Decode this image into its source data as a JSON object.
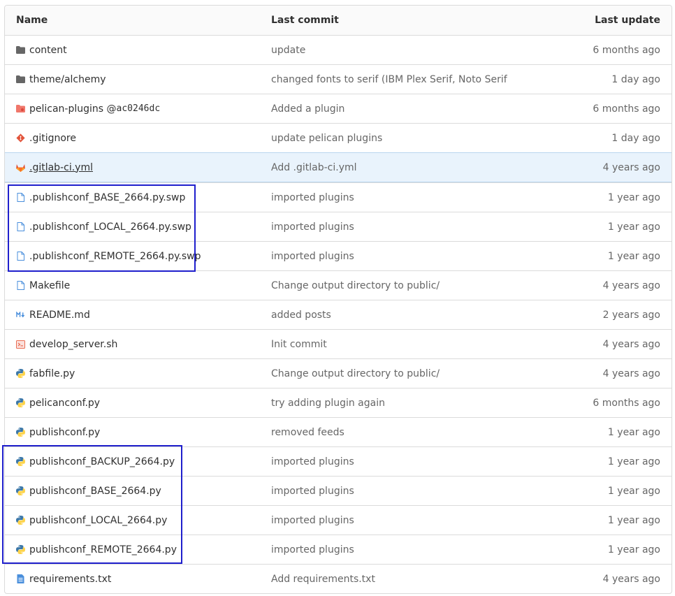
{
  "columns": {
    "name": "Name",
    "last_commit": "Last commit",
    "last_update": "Last update"
  },
  "rows": [
    {
      "name": "content",
      "commit": "update",
      "date": "6 months ago",
      "icon": "folder-icon"
    },
    {
      "name": "theme/alchemy",
      "commit": "changed fonts to serif (IBM Plex Serif, Noto Serif",
      "date": "1 day ago",
      "icon": "folder-icon"
    },
    {
      "name": "pelican-plugins @ ",
      "hash": "ac0246dc",
      "commit": "Added a plugin",
      "date": "6 months ago",
      "icon": "submodule-folder-icon"
    },
    {
      "name": ".gitignore",
      "commit": "update pelican plugins",
      "date": "1 day ago",
      "icon": "git-icon"
    },
    {
      "name": ".gitlab-ci.yml",
      "commit": "Add .gitlab-ci.yml",
      "date": "4 years ago",
      "icon": "gitlab-icon"
    },
    {
      "name": ".publishconf_BASE_2664.py.swp",
      "commit": "imported plugins",
      "date": "1 year ago",
      "icon": "file-icon"
    },
    {
      "name": ".publishconf_LOCAL_2664.py.swp",
      "commit": "imported plugins",
      "date": "1 year ago",
      "icon": "file-icon"
    },
    {
      "name": ".publishconf_REMOTE_2664.py.swp",
      "commit": "imported plugins",
      "date": "1 year ago",
      "icon": "file-icon"
    },
    {
      "name": "Makefile",
      "commit": "Change output directory to public/",
      "date": "4 years ago",
      "icon": "file-icon"
    },
    {
      "name": "README.md",
      "commit": "added posts",
      "date": "2 years ago",
      "icon": "markdown-icon"
    },
    {
      "name": "develop_server.sh",
      "commit": "Init commit",
      "date": "4 years ago",
      "icon": "terminal-icon"
    },
    {
      "name": "fabfile.py",
      "commit": "Change output directory to public/",
      "date": "4 years ago",
      "icon": "python-icon"
    },
    {
      "name": "pelicanconf.py",
      "commit": "try adding plugin again",
      "date": "6 months ago",
      "icon": "python-icon"
    },
    {
      "name": "publishconf.py",
      "commit": "removed feeds",
      "date": "1 year ago",
      "icon": "python-icon"
    },
    {
      "name": "publishconf_BACKUP_2664.py",
      "commit": "imported plugins",
      "date": "1 year ago",
      "icon": "python-icon"
    },
    {
      "name": "publishconf_BASE_2664.py",
      "commit": "imported plugins",
      "date": "1 year ago",
      "icon": "python-icon"
    },
    {
      "name": "publishconf_LOCAL_2664.py",
      "commit": "imported plugins",
      "date": "1 year ago",
      "icon": "python-icon"
    },
    {
      "name": "publishconf_REMOTE_2664.py",
      "commit": "imported plugins",
      "date": "1 year ago",
      "icon": "python-icon"
    },
    {
      "name": "requirements.txt",
      "commit": "Add requirements.txt",
      "date": "4 years ago",
      "icon": "text-file-icon"
    }
  ],
  "colors": {
    "highlight_box": "#1f1fcc",
    "hover_row": "#e9f3fc"
  }
}
